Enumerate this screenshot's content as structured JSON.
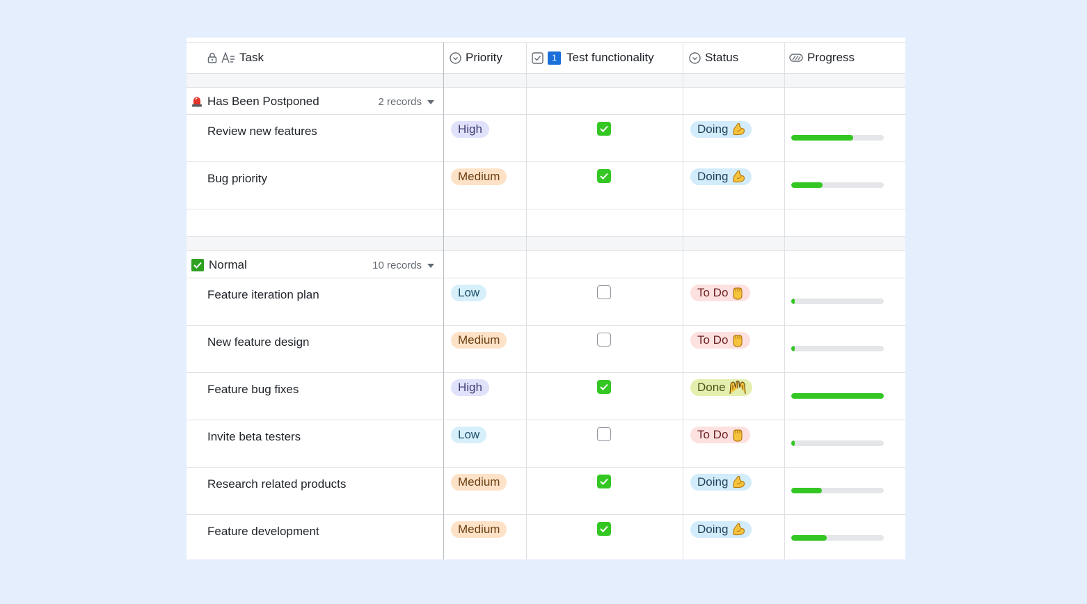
{
  "header": {
    "task": "Task",
    "priority": "Priority",
    "test_badge": "1",
    "test_functionality": "Test functionality",
    "status": "Status",
    "progress": "Progress"
  },
  "groups": [
    {
      "title": "Has Been Postponed",
      "icon": "red-alarm-light-icon",
      "count": "2 records",
      "rows": [
        {
          "task": "Review new features",
          "priority": "High",
          "tested": true,
          "status": "Doing",
          "status_icon": "flexed-biceps-icon",
          "progress": 0.67
        },
        {
          "task": "Bug priority",
          "priority": "Medium",
          "tested": true,
          "status": "Doing",
          "status_icon": "flexed-biceps-icon",
          "progress": 0.34
        }
      ]
    },
    {
      "title": "Normal",
      "icon": "green-check-icon",
      "count": "10 records",
      "rows": [
        {
          "task": "Feature iteration plan",
          "priority": "Low",
          "tested": false,
          "status": "To Do",
          "status_icon": "raised-fist-icon",
          "progress": 0.04
        },
        {
          "task": "New feature design",
          "priority": "Medium",
          "tested": false,
          "status": "To Do",
          "status_icon": "raised-fist-icon",
          "progress": 0.04
        },
        {
          "task": "Feature bug fixes",
          "priority": "High",
          "tested": true,
          "status": "Done",
          "status_icon": "raised-hands-icon",
          "progress": 1.0
        },
        {
          "task": "Invite beta testers",
          "priority": "Low",
          "tested": false,
          "status": "To Do",
          "status_icon": "raised-fist-icon",
          "progress": 0.04
        },
        {
          "task": "Research related products",
          "priority": "Medium",
          "tested": true,
          "status": "Doing",
          "status_icon": "flexed-biceps-icon",
          "progress": 0.33
        },
        {
          "task": "Feature development",
          "priority": "Medium",
          "tested": true,
          "status": "Doing",
          "status_icon": "flexed-biceps-icon",
          "progress": 0.38
        }
      ]
    }
  ],
  "colors": {
    "background": "#e4eefc",
    "progress_fill": "#34c724",
    "checkbox_on": "#34c724"
  }
}
